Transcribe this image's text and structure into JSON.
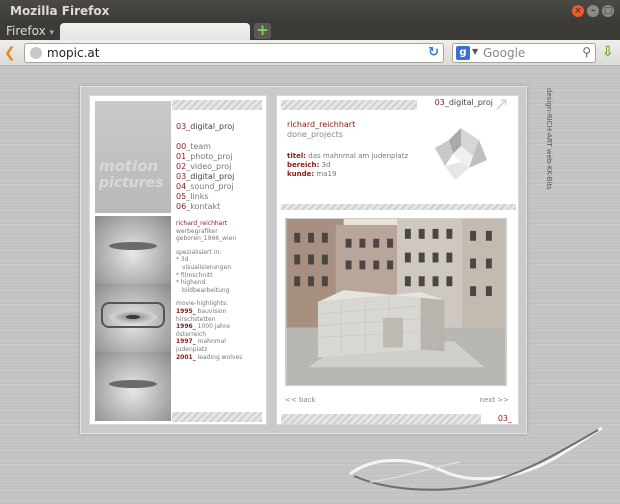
{
  "window": {
    "title": "Mozilla Firefox"
  },
  "menu": {
    "firefox_label": "Firefox",
    "firefox_caret": "▾"
  },
  "tabs": {
    "new_tab_symbol": "+"
  },
  "navigation": {
    "url": "mopic.at",
    "search_placeholder": "Google",
    "search_engine_letter": "g"
  },
  "left_panel": {
    "logo_word_1": "motion",
    "logo_word_2": "pictures",
    "heading_prefix": "03_",
    "heading_rest": "digital_proj",
    "menu": [
      {
        "num": "00",
        "label": "team"
      },
      {
        "num": "01",
        "label": "photo_proj"
      },
      {
        "num": "02",
        "label": "video_proj"
      },
      {
        "num": "03",
        "label": "digital_proj"
      },
      {
        "num": "04",
        "label": "sound_proj"
      },
      {
        "num": "05",
        "label": "links"
      },
      {
        "num": "06",
        "label": "kontakt"
      }
    ],
    "bio": {
      "name": "richard_reichhart",
      "role": "werbegrafiker",
      "born": "geboren_1966_wien",
      "spec_title": "spezialisiert in:",
      "spec_items": [
        "* 3d",
        "  visualisierungen",
        "* filmschnitt",
        "* highend",
        "  bildbearbeitung"
      ],
      "highlights_title": "movie-highlights:",
      "highlights": [
        {
          "year": "1995_",
          "text": "bauvision"
        },
        {
          "year": "",
          "text": "hirschstetten"
        },
        {
          "year": "1996_",
          "text": "1000 jahre"
        },
        {
          "year": "",
          "text": "österreich"
        },
        {
          "year": "1997_",
          "text": "mahnmal"
        },
        {
          "year": "",
          "text": "judenplatz"
        },
        {
          "year": "2001_",
          "text": "leading wolves"
        }
      ]
    }
  },
  "right_panel": {
    "tab_prefix": "03_",
    "tab_rest": "digital_proj",
    "name": "richard_reichhart",
    "subtitle": "done_projects",
    "info": [
      {
        "key": "titel:",
        "value": "das mahnmal am judenplatz"
      },
      {
        "key": "bereich:",
        "value": "3d"
      },
      {
        "key": "kunde:",
        "value": "ma19"
      }
    ],
    "back_label": "<< back",
    "next_label": "next >>",
    "page_number": "03_"
  },
  "credits": "design-RICH-ART  web-KK-Bits",
  "colors": {
    "accent": "#8b1a1a",
    "metal": "#c1c3c5"
  }
}
